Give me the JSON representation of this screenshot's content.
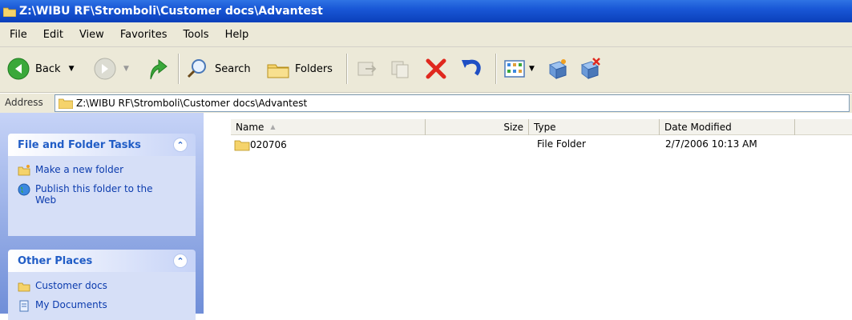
{
  "window": {
    "title": "Z:\\WIBU RF\\Stromboli\\Customer docs\\Advantest"
  },
  "menu": [
    "File",
    "Edit",
    "View",
    "Favorites",
    "Tools",
    "Help"
  ],
  "toolbar": {
    "back_label": "Back",
    "search_label": "Search",
    "folders_label": "Folders"
  },
  "address": {
    "label": "Address",
    "value": "Z:\\WIBU RF\\Stromboli\\Customer docs\\Advantest"
  },
  "tasks_panel": {
    "title": "File and Folder Tasks",
    "items": [
      {
        "label": "Make a new folder",
        "icon": "new-folder-icon"
      },
      {
        "label": "Publish this folder to the Web",
        "icon": "globe-icon"
      }
    ]
  },
  "places_panel": {
    "title": "Other Places",
    "items": [
      {
        "label": "Customer docs",
        "icon": "folder-icon"
      },
      {
        "label": "My Documents",
        "icon": "documents-icon"
      }
    ]
  },
  "columns": {
    "name": "Name",
    "size": "Size",
    "type": "Type",
    "date": "Date Modified"
  },
  "files": [
    {
      "name": "020706",
      "size": "",
      "type": "File Folder",
      "date": "2/7/2006 10:13 AM"
    }
  ],
  "colors": {
    "titlebar": "#0a3fba",
    "chrome": "#ece9d8",
    "task_link": "#0c3cae",
    "panel_title": "#215dc6"
  }
}
